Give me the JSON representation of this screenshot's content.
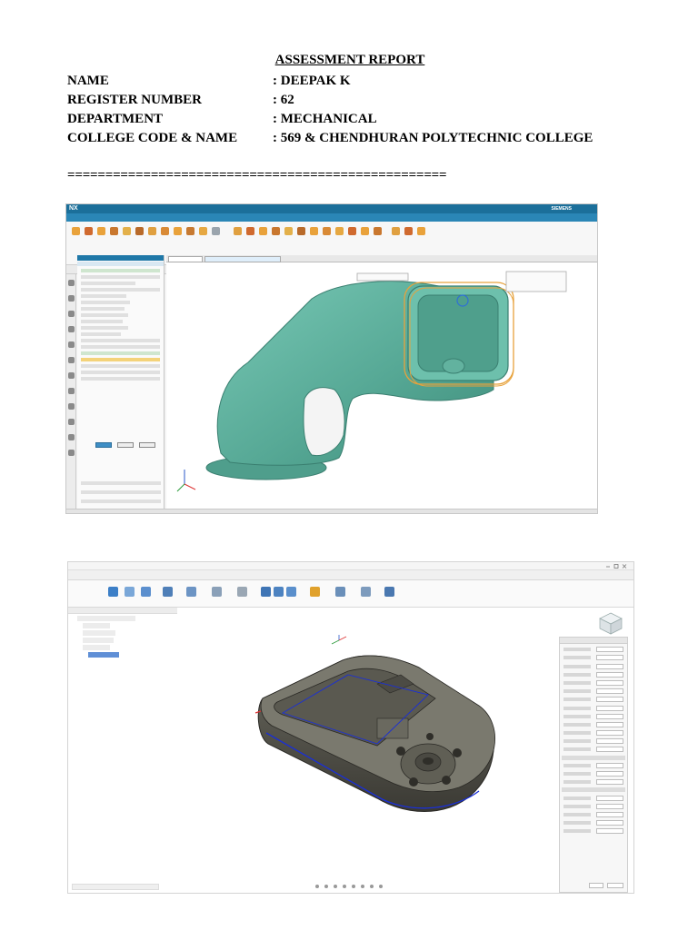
{
  "report": {
    "title": "ASSESSMENT REPORT",
    "fields": [
      {
        "label": "NAME",
        "value": ": DEEPAK K"
      },
      {
        "label": "REGISTER NUMBER",
        "value": ": 62"
      },
      {
        "label": "DEPARTMENT",
        "value": ": MECHANICAL"
      },
      {
        "label": "COLLEGE CODE & NAME",
        "value": ": 569 & CHENDHURAN POLYTECHNIC COLLEGE"
      }
    ],
    "divider": "=================================================="
  },
  "colors": {
    "nx_title_bar": "#1b6f9a",
    "nx_model": "#5fb3a1",
    "fusion_model": "#4a4a42",
    "toolpath": "#1a2fd6",
    "offset_curve": "#e7a23c"
  }
}
